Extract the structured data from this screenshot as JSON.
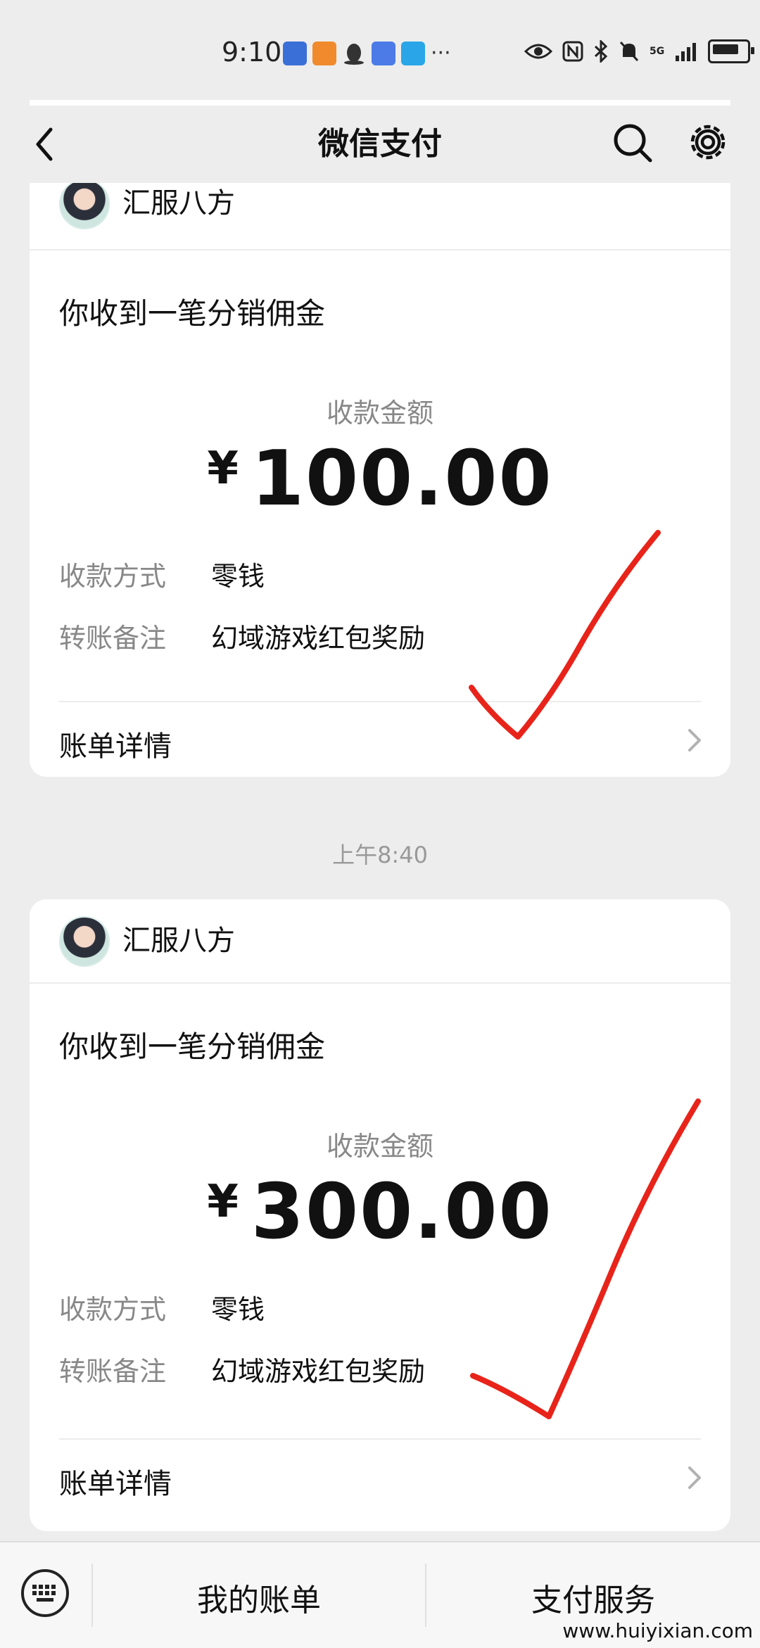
{
  "status_bar": {
    "time": "9:10",
    "more": "···",
    "network": "5G"
  },
  "nav": {
    "title": "微信支付",
    "back_icon": "chevron-left-icon",
    "search_icon": "search-icon",
    "settings_icon": "gear-icon"
  },
  "cards": [
    {
      "sender": "汇服八方",
      "title": "你收到一笔分销佣金",
      "amount_label": "收款金额",
      "currency": "¥",
      "amount": "100.00",
      "method_label": "收款方式",
      "method_value": "零钱",
      "note_label": "转账备注",
      "note_value": "幻域游戏红包奖励",
      "detail_label": "账单详情"
    },
    {
      "sender": "汇服八方",
      "title": "你收到一笔分销佣金",
      "amount_label": "收款金额",
      "currency": "¥",
      "amount": "300.00",
      "method_label": "收款方式",
      "method_value": "零钱",
      "note_label": "转账备注",
      "note_value": "幻域游戏红包奖励",
      "detail_label": "账单详情"
    }
  ],
  "timestamp": "上午8:40",
  "bottom_bar": {
    "keyboard_icon": "keyboard-icon",
    "my_bills": "我的账单",
    "pay_services": "支付服务"
  },
  "watermark": "www.huiyixian.com",
  "colors": {
    "background": "#ededed",
    "card": "#ffffff",
    "check_mark": "#e8241a",
    "muted_text": "#888888"
  }
}
